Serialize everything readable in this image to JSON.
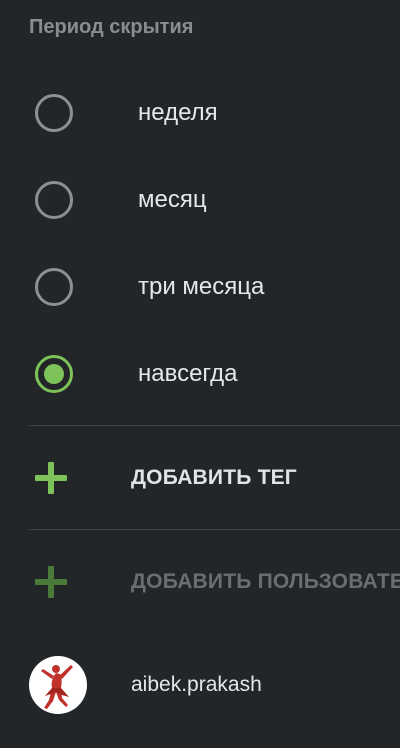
{
  "section": {
    "title": "Период скрытия"
  },
  "period_options": [
    {
      "label": "неделя",
      "selected": false
    },
    {
      "label": "месяц",
      "selected": false
    },
    {
      "label": "три месяца",
      "selected": false
    },
    {
      "label": "навсегда",
      "selected": true
    }
  ],
  "actions": {
    "add_tag": {
      "label": "ДОБАВИТЬ ТЕГ",
      "enabled": true
    },
    "add_user": {
      "label": "ДОБАВИТЬ ПОЛЬЗОВАТЕЛЯ",
      "enabled": false
    }
  },
  "user": {
    "name": "aibek.prakash",
    "avatar_icon": "dancer-silhouette-icon"
  },
  "colors": {
    "background": "#232629",
    "accent": "#7ec25a",
    "accent_disabled": "#4c7a3a",
    "text_primary": "#e6e7e8",
    "text_secondary": "#8a8d90",
    "radio_unselected": "#8e9194",
    "divider": "#3f4245",
    "avatar_figure": "#c0312b"
  }
}
